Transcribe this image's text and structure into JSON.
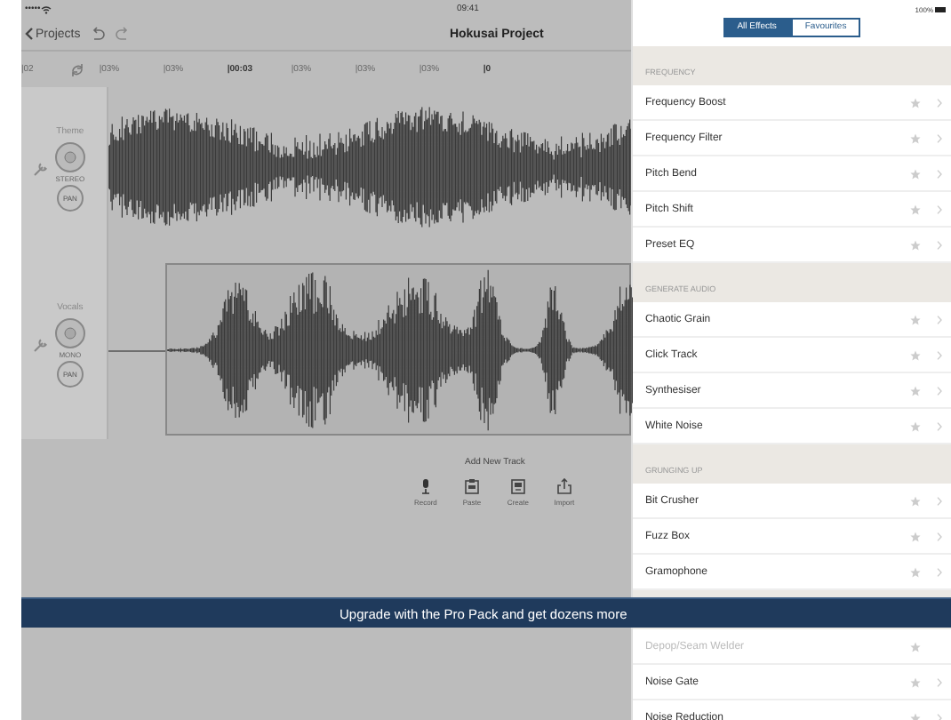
{
  "status_bar": {
    "signal": "•••••",
    "time": "09:41",
    "battery": "100%"
  },
  "nav": {
    "back": "Projects",
    "title": "Hokusai Project"
  },
  "ruler": [
    {
      "label": "|02",
      "bold": false
    },
    {
      "label": "|03%",
      "bold": false
    },
    {
      "label": "|03%",
      "bold": false
    },
    {
      "label": "|00:03",
      "bold": true
    },
    {
      "label": "|03%",
      "bold": false
    },
    {
      "label": "|03%",
      "bold": false
    },
    {
      "label": "|03%",
      "bold": false
    },
    {
      "label": "|0",
      "bold": true
    }
  ],
  "tracks": [
    {
      "name": "Theme",
      "channel": "STEREO",
      "pan": "PAN",
      "kind": "dense",
      "selected": false
    },
    {
      "name": "Vocals",
      "channel": "MONO",
      "pan": "PAN",
      "kind": "bursts",
      "selected": true
    }
  ],
  "add_track": {
    "title": "Add New Track",
    "actions": [
      {
        "label": "Record",
        "kind": "mic"
      },
      {
        "label": "Paste",
        "kind": "clipboard"
      },
      {
        "label": "Create",
        "kind": "create"
      },
      {
        "label": "Import",
        "kind": "import"
      }
    ]
  },
  "banner": "Upgrade with the Pro Pack and get dozens more",
  "effects": {
    "tabs": [
      {
        "label": "All Effects",
        "selected": true
      },
      {
        "label": "Favourites",
        "selected": false
      }
    ],
    "sections": [
      {
        "title": "FREQUENCY",
        "items": [
          {
            "label": "Frequency Boost",
            "disabled": false
          },
          {
            "label": "Frequency Filter",
            "disabled": false
          },
          {
            "label": "Pitch Bend",
            "disabled": false
          },
          {
            "label": "Pitch Shift",
            "disabled": false
          },
          {
            "label": "Preset EQ",
            "disabled": false
          }
        ]
      },
      {
        "title": "GENERATE AUDIO",
        "items": [
          {
            "label": "Chaotic Grain",
            "disabled": false
          },
          {
            "label": "Click Track",
            "disabled": false
          },
          {
            "label": "Synthesiser",
            "disabled": false
          },
          {
            "label": "White Noise",
            "disabled": false
          }
        ]
      },
      {
        "title": "GRUNGING UP",
        "items": [
          {
            "label": "Bit Crusher",
            "disabled": false
          },
          {
            "label": "Fuzz Box",
            "disabled": false
          },
          {
            "label": "Gramophone",
            "disabled": false
          }
        ]
      },
      {
        "items": [
          {
            "label": "Depop/Seam Welder",
            "disabled": true
          },
          {
            "label": "Noise Gate",
            "disabled": false
          },
          {
            "label": "Noise Reduction",
            "disabled": false
          }
        ]
      }
    ]
  }
}
